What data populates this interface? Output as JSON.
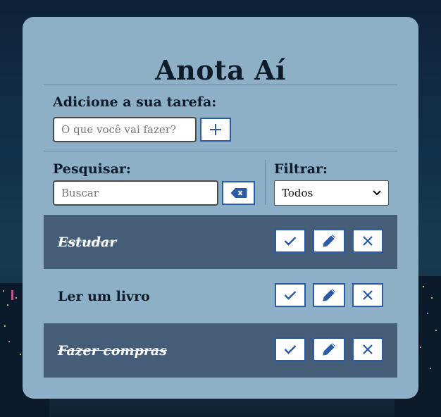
{
  "app": {
    "title": "Anota Aí"
  },
  "add": {
    "label": "Adicione a sua tarefa:",
    "placeholder": "O que você vai fazer?"
  },
  "search": {
    "label": "Pesquisar:",
    "placeholder": "Buscar"
  },
  "filter": {
    "label": "Filtrar:",
    "selected": "Todos"
  },
  "todos": [
    {
      "text": "Estudar",
      "done": true
    },
    {
      "text": "Ler um livro",
      "done": false
    },
    {
      "text": "Fazer compras",
      "done": true
    }
  ],
  "icons": {
    "add": "plus-icon",
    "clear": "backspace-icon",
    "finish": "check-icon",
    "edit": "pencil-icon",
    "remove": "x-icon",
    "select": "chevron-down-icon"
  },
  "colors": {
    "card": "#8eb0c6",
    "done_row": "#455d77",
    "accent": "#2a5aa8",
    "text": "#0d1b2a"
  }
}
